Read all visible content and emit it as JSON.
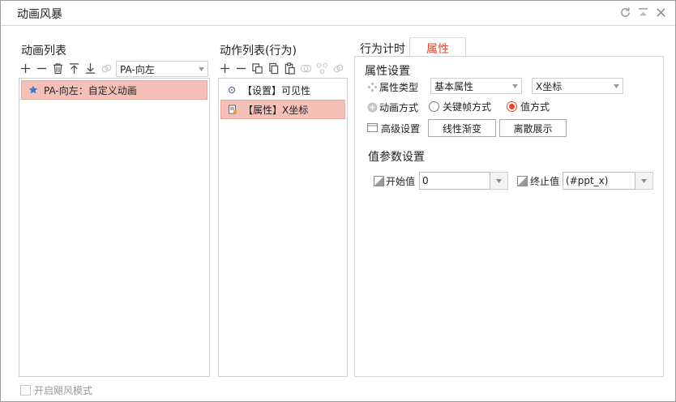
{
  "window": {
    "title": "动画风暴"
  },
  "animation_list": {
    "title": "动画列表",
    "selector_value": "PA-向左",
    "items": [
      {
        "label": "PA-向左：自定义动画",
        "selected": true
      }
    ]
  },
  "action_list": {
    "title": "动作列表(行为)",
    "items": [
      {
        "label": "【设置】可见性",
        "selected": false
      },
      {
        "label": "【属性】X坐标",
        "selected": true
      }
    ]
  },
  "tabs": {
    "timer_label": "行为计时",
    "attr_label": "属性"
  },
  "props": {
    "section_title": "属性设置",
    "type_label": "属性类型",
    "type_value": "基本属性",
    "attr_value": "X坐标",
    "method_label": "动画方式",
    "method_keyframe": "关键帧方式",
    "method_value": "值方式",
    "advanced_label": "高级设置",
    "linear_btn": "线性渐变",
    "discrete_btn": "离散展示",
    "value_section_title": "值参数设置",
    "start_label": "开始值",
    "start_value": "0",
    "end_label": "终止值",
    "end_value": "(#ppt_x)"
  },
  "footer": {
    "storm_mode_label": "开启飓风模式"
  },
  "colors": {
    "accent": "#e0472d",
    "selection_bg": "#f5c0b8"
  }
}
